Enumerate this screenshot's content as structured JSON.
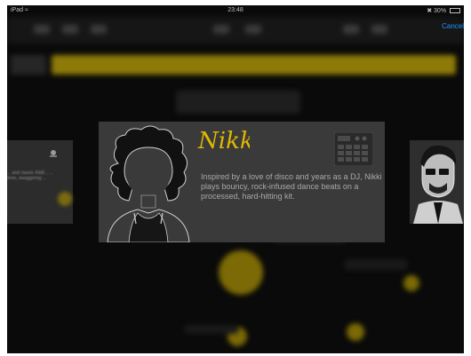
{
  "status_bar": {
    "device": "iPad",
    "time": "23:48",
    "battery": "30%"
  },
  "header": {
    "cancel_label": "Cancel"
  },
  "drummer_card": {
    "name": "Nikki",
    "description": "Inspired by a love of disco and years as a DJ, Nikki plays bouncy, rock-infused dance beats on a processed, hard-hitting kit."
  },
  "left_card": {
    "description": "... and classic R&B... ... lines, swaggering ..."
  },
  "colors": {
    "accent": "#d9b400",
    "link": "#1e90ff",
    "card": "#3a3a3a"
  }
}
